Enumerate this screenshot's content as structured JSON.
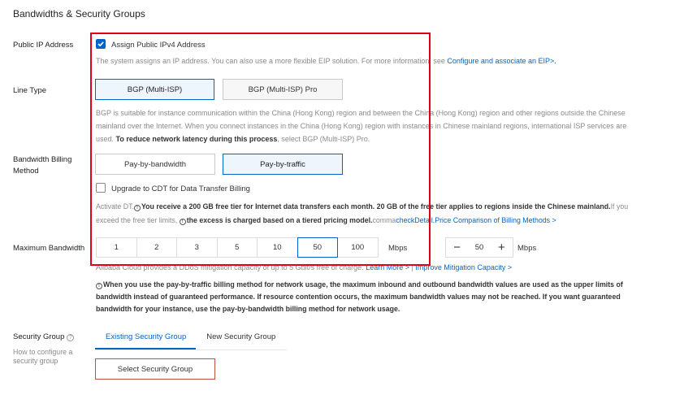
{
  "section_title": "Bandwidths & Security Groups",
  "public_ip": {
    "label": "Public IP Address",
    "checkbox_label": "Assign Public IPv4 Address",
    "checked": true,
    "desc_text": "The system assigns an IP address. You can also use a more flexible EIP solution. For more information, see ",
    "desc_link": "Configure and associate an EIP>."
  },
  "line_type": {
    "label": "Line Type",
    "options": [
      "BGP (Multi-ISP)",
      "BGP (Multi-ISP) Pro"
    ],
    "selected": "BGP (Multi-ISP)",
    "desc_line1": "BGP is suitable for instance communication within the China (Hong Kong) region and between the China (Hong Kong) region and other regions outside the Chinese",
    "desc_line2": "mainland over the Internet. When you connect instances in the China (Hong Kong) region with instances in Chinese mainland regions, international ISP services are",
    "desc_line3_a": "used. ",
    "desc_line3_bold": "To reduce network latency during this process",
    "desc_line3_b": ", select BGP (Multi-ISP) Pro."
  },
  "billing": {
    "label_line1": "Bandwidth Billing",
    "label_line2": "Method",
    "options": [
      "Pay-by-bandwidth",
      "Pay-by-traffic"
    ],
    "selected": "Pay-by-traffic",
    "cdt_label": "Upgrade to CDT for Data Transfer Billing",
    "cdt_checked": false,
    "note1_a": "Activate DT.",
    "note1_bold1": "You receive a 200 GB free tier for Internet data transfers each month. 20 GB of the free tier applies to regions inside the Chinese mainland.",
    "note1_b": "If you",
    "note2_a": "exceed the free tier limits, ",
    "note2_bold": "the excess is charged based on a tiered pricing model.",
    "note2_comma": "comma",
    "note2_link": "checkDetail.Price Comparison of Billing Methods >"
  },
  "max_bandwidth": {
    "label": "Maximum Bandwidth",
    "options": [
      "1",
      "2",
      "3",
      "5",
      "10",
      "50",
      "100"
    ],
    "selected": "50",
    "unit": "Mbps",
    "stepper_minus": "−",
    "stepper_value": "50",
    "stepper_plus": "+",
    "stepper_unit": "Mbps",
    "ddos_text": "Alibaba Cloud provides a DDoS mitigation capacity of up to 5 Gbit/s free of charge. ",
    "ddos_link1": "Learn More >",
    "ddos_sep": " | ",
    "ddos_link2": "Improve Mitigation Capacity >",
    "warn_line1": "When you use the pay-by-traffic billing method for network usage, the maximum inbound and outbound bandwidth values are used as the upper limits of",
    "warn_line2": "bandwidth instead of guaranteed performance. If resource contention occurs, the maximum bandwidth values may not be reached. If you want guaranteed",
    "warn_line3": "bandwidth for your instance, use the pay-by-bandwidth billing method for network usage."
  },
  "security_group": {
    "label": "Security Group",
    "help_line1": "How to configure a",
    "help_line2": "security group",
    "tabs": [
      "Existing Security Group",
      "New Security Group"
    ],
    "active_tab": "Existing Security Group",
    "select_button": "Select Security Group"
  },
  "colors": {
    "accent": "#0064c8",
    "highlight_border": "#e0001b",
    "button_border": "#c0513a"
  }
}
